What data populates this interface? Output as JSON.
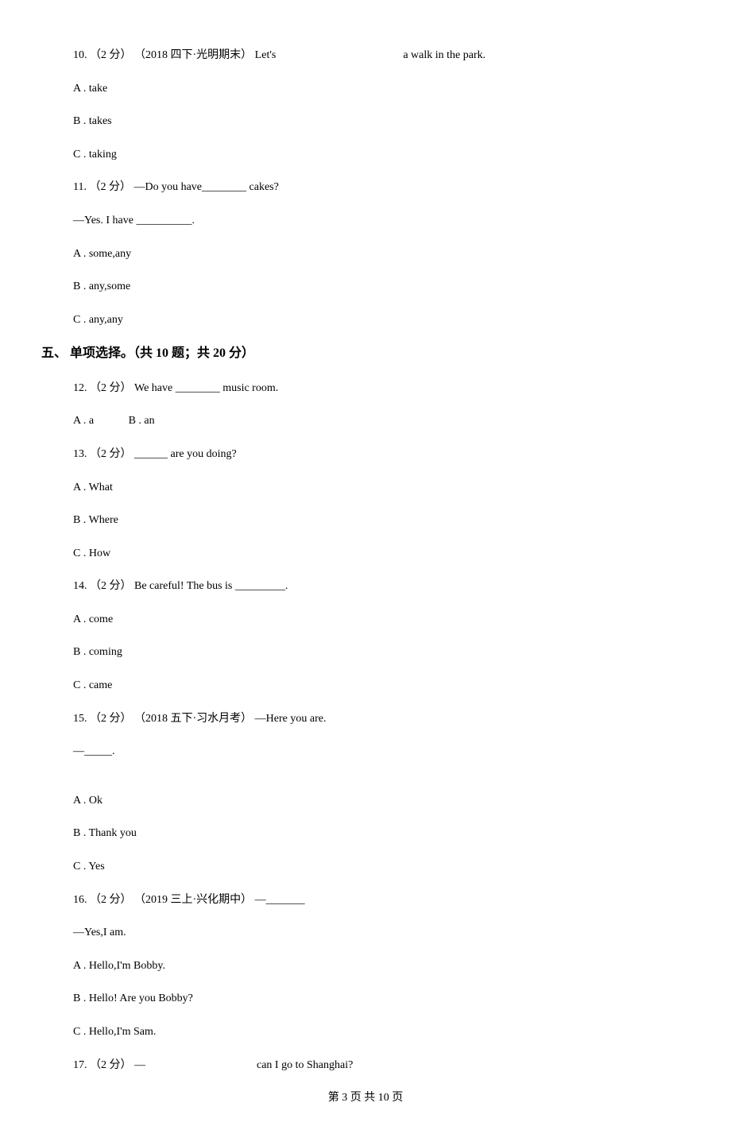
{
  "q10": {
    "num": "10.",
    "pts": "（2 分）",
    "src": "（2018 四下·光明期末）",
    "text_left": "Let's",
    "text_right": "a walk in the park.",
    "optA": "A . take",
    "optB": "B . takes",
    "optC": "C . taking"
  },
  "q11": {
    "num": "11.",
    "pts": "（2 分）",
    "text1": " —Do you have________ cakes?",
    "text2": "—Yes. I have __________.",
    "optA": "A . some,any",
    "optB": "B . any,some",
    "optC": "C . any,any"
  },
  "section5": {
    "heading": "五、 单项选择。（共 10 题；共 20 分）"
  },
  "q12": {
    "num": "12.",
    "pts": "（2 分）",
    "text": " We have ________ music room.",
    "optA": "A . a",
    "optB": "B . an"
  },
  "q13": {
    "num": "13.",
    "pts": "（2 分）",
    "text": " ______ are you doing?",
    "optA": "A . What",
    "optB": "B . Where",
    "optC": "C . How"
  },
  "q14": {
    "num": "14.",
    "pts": "（2 分）",
    "text": " Be careful! The bus is _________.",
    "optA": "A . come",
    "optB": "B . coming",
    "optC": "C . came"
  },
  "q15": {
    "num": "15.",
    "pts": "（2 分）",
    "src": "（2018 五下·习水月考）",
    "text": "—Here you are.",
    "text2": "—_____.",
    "optA": "A . Ok",
    "optB": "B . Thank you",
    "optC": "C . Yes"
  },
  "q16": {
    "num": "16.",
    "pts": "（2 分）",
    "src": "（2019 三上·兴化期中）",
    "text": "—_______",
    "text2": "—Yes,I am.",
    "optA": "A . Hello,I'm Bobby.",
    "optB": "B . Hello! Are you Bobby?",
    "optC": "C . Hello,I'm Sam."
  },
  "q17": {
    "num": "17.",
    "pts": "（2 分）",
    "text_left": " —",
    "text_right": "can I go to Shanghai?"
  },
  "footer": {
    "text": "第 3 页 共 10 页"
  }
}
